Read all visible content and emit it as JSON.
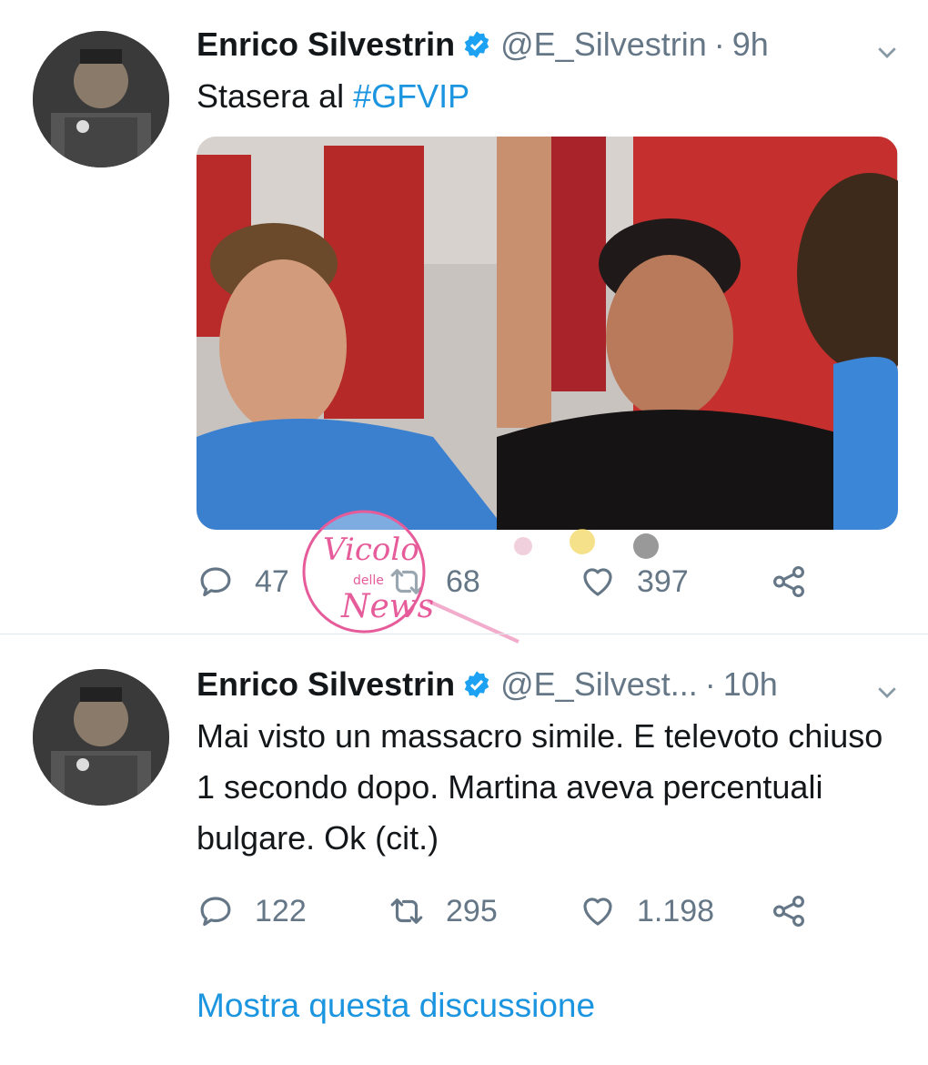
{
  "tweets": [
    {
      "name": "Enrico Silvestrin",
      "handle": "@E_Silvestrin",
      "time": "9h",
      "text_plain": "Stasera al ",
      "hashtag": "#GFVIP",
      "reply_count": "47",
      "retweet_count": "68",
      "like_count": "397"
    },
    {
      "name": "Enrico Silvestrin",
      "handle": "@E_Silvest...",
      "time": "10h",
      "text": "Mai visto un massacro simile. E televoto chiuso 1 secondo dopo. Martina aveva percentuali bulgare. Ok (cit.)",
      "reply_count": "122",
      "retweet_count": "295",
      "like_count": "1.198"
    }
  ],
  "show_thread": "Mostra questa discussione",
  "watermark": {
    "line1": "Vicolo",
    "line2": "delle",
    "line3": "News"
  },
  "colors": {
    "link": "#1b95e0",
    "secondary_text": "#657786",
    "verified_badge": "#1da1f2",
    "divider": "#e1e8ed"
  },
  "icons": [
    "verified-badge-icon",
    "chevron-down-icon",
    "reply-icon",
    "retweet-icon",
    "like-icon",
    "share-icon"
  ]
}
